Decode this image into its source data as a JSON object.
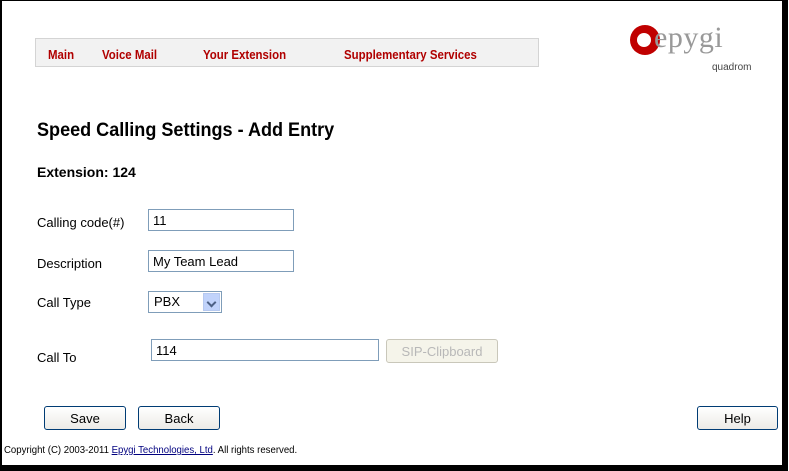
{
  "nav": {
    "items": [
      "Main",
      "Voice Mail",
      "Your Extension",
      "Supplementary Services"
    ]
  },
  "logo": {
    "brand": "epygi",
    "sub": "quadrom"
  },
  "page": {
    "title": "Speed Calling Settings - Add Entry",
    "extension_label": "Extension: 124"
  },
  "form": {
    "calling_code_label": "Calling code(#)",
    "calling_code_value": "11",
    "description_label": "Description",
    "description_value": "My Team Lead",
    "call_type_label": "Call Type",
    "call_type_value": "PBX",
    "call_to_label": "Call To",
    "call_to_value": "114",
    "sip_clipboard_label": "SIP-Clipboard"
  },
  "buttons": {
    "save": "Save",
    "back": "Back",
    "help": "Help"
  },
  "footer": {
    "prefix": "Copyright (C) 2003-2011 ",
    "link": "Epygi Technologies, Ltd",
    "suffix": ". All rights reserved."
  },
  "colors": {
    "nav_text": "#b00000",
    "brand_red": "#c00000",
    "nav_bg": "#f2f2f2"
  }
}
